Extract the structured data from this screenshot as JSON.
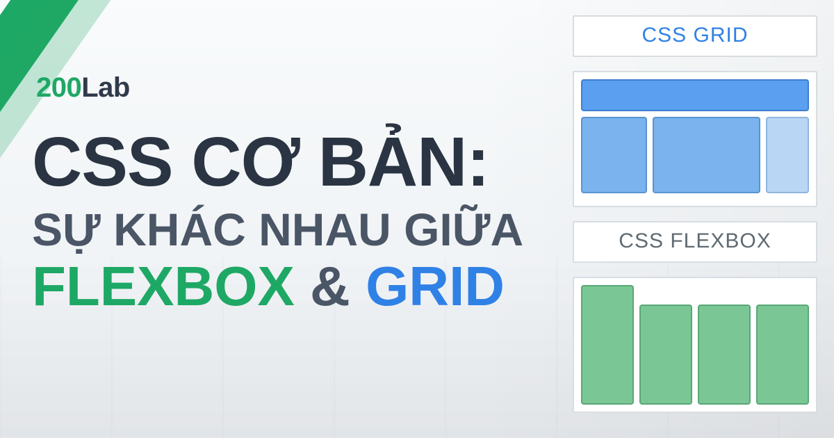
{
  "brand": {
    "number": "200",
    "text": "Lab"
  },
  "headline": {
    "line1": "CSS CƠ BẢN:",
    "line2": "SỰ KHÁC NHAU GIỮA",
    "kw1": "FLEXBOX",
    "amp": "&",
    "kw2": "GRID"
  },
  "right": {
    "grid_label": "CSS GRID",
    "flex_label": "CSS FLEXBOX"
  },
  "colors": {
    "brand_green": "#1ea865",
    "accent_blue": "#2f81e6",
    "text_dark": "#2a3442"
  }
}
